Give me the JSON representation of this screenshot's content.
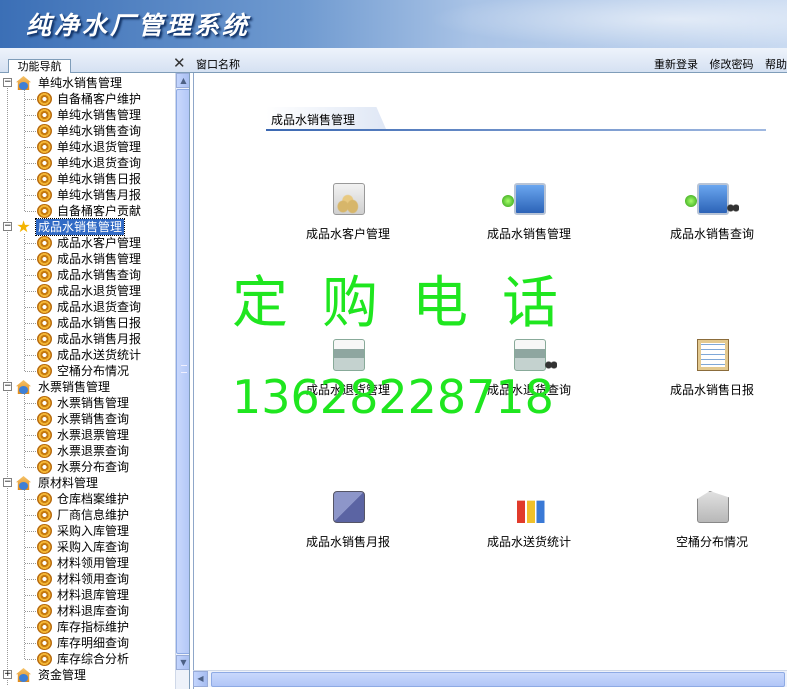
{
  "app": {
    "title": "纯净水厂管理系统"
  },
  "tabbar": {
    "nav_tab": "功能导航",
    "window_name": "窗口名称",
    "actions": [
      "重新登录",
      "修改密码",
      "帮助"
    ]
  },
  "tree": {
    "groups": [
      {
        "label": "单纯水销售管理",
        "expanded": true,
        "icon": "house-icon",
        "children": [
          "自备桶客户维护",
          "单纯水销售管理",
          "单纯水销售查询",
          "单纯水退货管理",
          "单纯水退货查询",
          "单纯水销售日报",
          "单纯水销售月报",
          "自备桶客户贡献"
        ]
      },
      {
        "label": "成品水销售管理",
        "expanded": true,
        "selected": true,
        "icon": "star-icon",
        "children": [
          "成品水客户管理",
          "成品水销售管理",
          "成品水销售查询",
          "成品水退货管理",
          "成品水退货查询",
          "成品水销售日报",
          "成品水销售月报",
          "成品水送货统计",
          "空桶分布情况"
        ]
      },
      {
        "label": "水票销售管理",
        "expanded": true,
        "icon": "house-icon",
        "children": [
          "水票销售管理",
          "水票销售查询",
          "水票退票管理",
          "水票退票查询",
          "水票分布查询"
        ]
      },
      {
        "label": "原材料管理",
        "expanded": true,
        "icon": "house-icon",
        "children": [
          "仓库档案维护",
          "厂商信息维护",
          "采购入库管理",
          "采购入库查询",
          "材料领用管理",
          "材料领用查询",
          "材料退库管理",
          "材料退库查询",
          "库存指标维护",
          "库存明细查询",
          "库存综合分析"
        ]
      },
      {
        "label": "资金管理",
        "expanded": false,
        "icon": "house-icon",
        "children": []
      }
    ]
  },
  "main": {
    "section_title": "成品水销售管理",
    "tiles": [
      {
        "label": "成品水客户管理",
        "icon": "customer-stack-icon"
      },
      {
        "label": "成品水销售管理",
        "icon": "sales-monitor-icon"
      },
      {
        "label": "成品水销售查询",
        "icon": "search-monitor-icon"
      },
      {
        "label": "成品水退货管理",
        "icon": "return-printer-icon"
      },
      {
        "label": "成品水退货查询",
        "icon": "return-search-icon"
      },
      {
        "label": "成品水销售日报",
        "icon": "daily-report-icon"
      },
      {
        "label": "成品水销售月报",
        "icon": "monthly-report-icon"
      },
      {
        "label": "成品水送货统计",
        "icon": "delivery-chart-icon"
      },
      {
        "label": "空桶分布情况",
        "icon": "bucket-distribution-icon"
      }
    ]
  },
  "watermark": {
    "line1": "定购电话",
    "line2": "13628228718"
  }
}
